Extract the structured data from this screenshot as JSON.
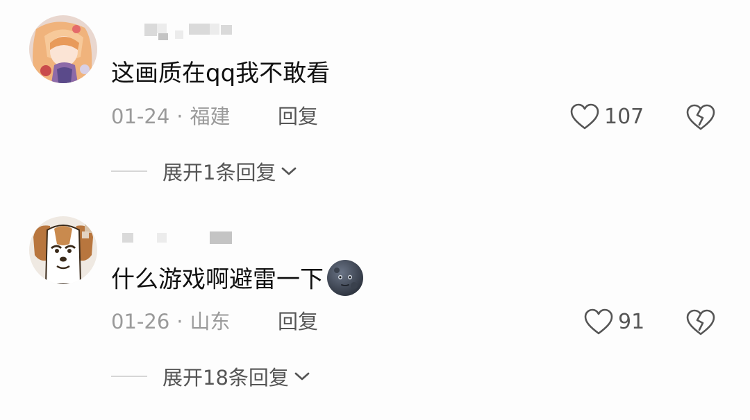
{
  "comments": [
    {
      "text": "这画质在qq我不敢看",
      "date": "01-24",
      "separator": "·",
      "location": "福建",
      "reply_label": "回复",
      "likes": "107",
      "expand_label": "展开1条回复",
      "avatar_icon": "anime-girl-avatar"
    },
    {
      "text": "什么游戏啊避雷一下",
      "emoji_icon": "moon-face-emoji",
      "date": "01-26",
      "separator": "·",
      "location": "山东",
      "reply_label": "回复",
      "likes": "91",
      "expand_label": "展开18条回复",
      "avatar_icon": "cartoon-dog-avatar"
    }
  ],
  "icons": {
    "like": "heart-outline-icon",
    "dislike": "broken-heart-icon",
    "expand": "chevron-down-icon"
  },
  "colors": {
    "text": "#111111",
    "meta": "#9a9a9a",
    "action": "#555555",
    "background": "#fdfdfd"
  }
}
